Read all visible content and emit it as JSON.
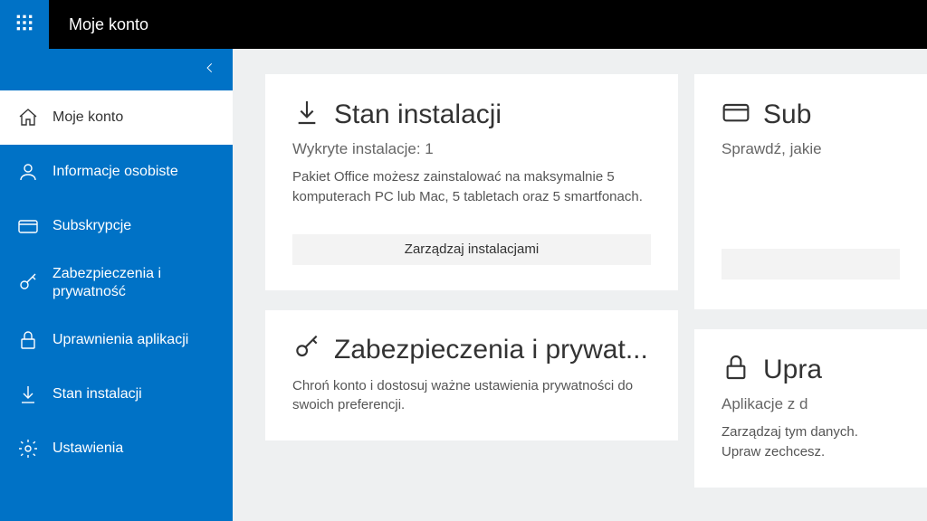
{
  "topbar": {
    "title": "Moje konto"
  },
  "sidebar": {
    "items": [
      {
        "label": "Moje konto"
      },
      {
        "label": "Informacje osobiste"
      },
      {
        "label": "Subskrypcje"
      },
      {
        "label": "Zabezpieczenia i prywatność"
      },
      {
        "label": "Uprawnienia aplikacji"
      },
      {
        "label": "Stan instalacji"
      },
      {
        "label": "Ustawienia"
      }
    ]
  },
  "cards": {
    "install": {
      "title": "Stan instalacji",
      "subtitle": "Wykryte instalacje: 1",
      "body": "Pakiet Office możesz zainstalować na maksymalnie 5 komputerach PC lub Mac, 5 tabletach oraz 5 smartfonach.",
      "button": "Zarządzaj instalacjami"
    },
    "subs": {
      "title": "Sub",
      "subtitle": "Sprawdź, jakie"
    },
    "security": {
      "title": "Zabezpieczenia i prywat...",
      "body": "Chroń konto i dostosuj ważne ustawienia prywatności do swoich preferencji."
    },
    "perms": {
      "title": "Upra",
      "subtitle": "Aplikacje z d",
      "body": "Zarządzaj tym danych. Upraw zechcesz."
    }
  }
}
